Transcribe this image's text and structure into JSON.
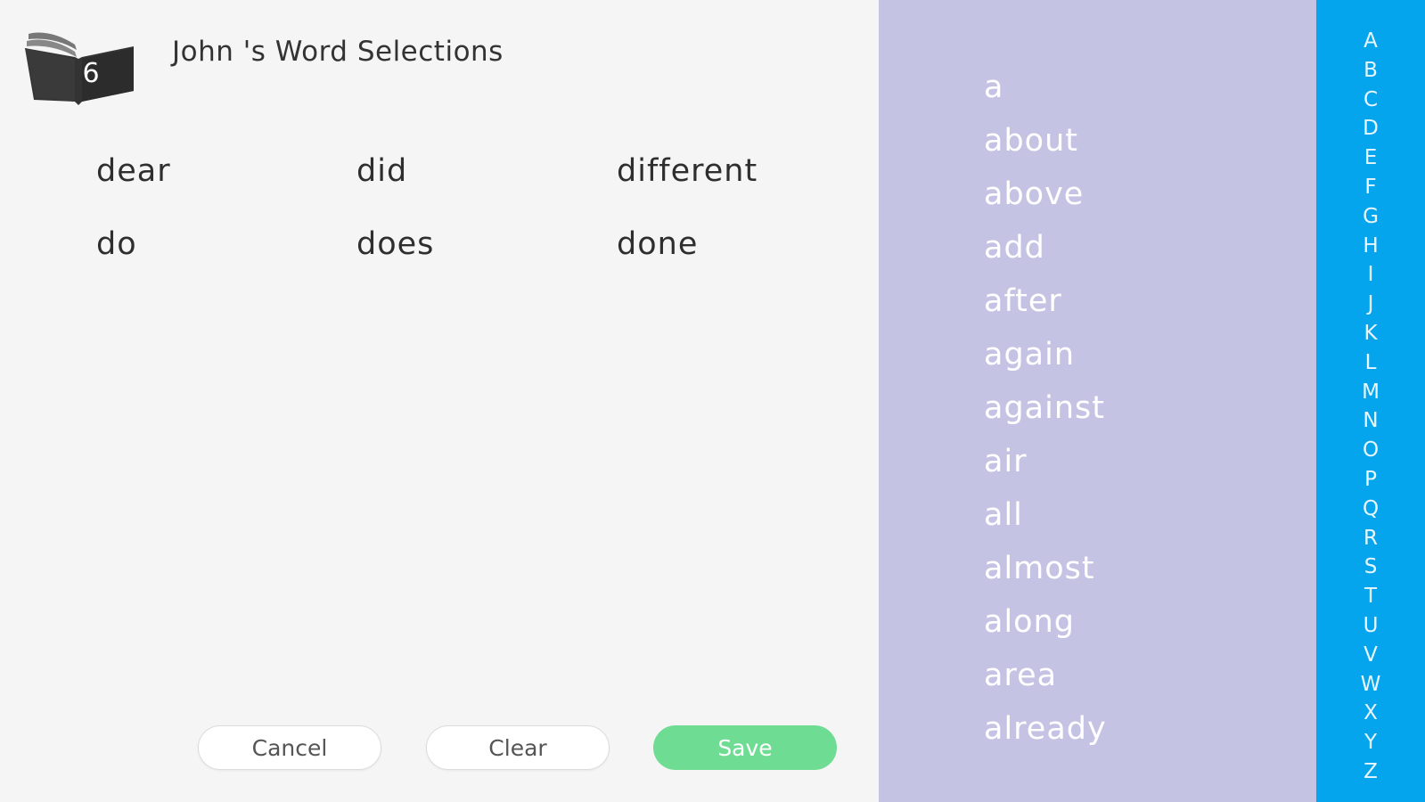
{
  "header": {
    "title": "John 's Word Selections",
    "book_level": "6"
  },
  "selected_words": [
    "dear",
    "did",
    "different",
    "do",
    "does",
    "done"
  ],
  "buttons": {
    "cancel": "Cancel",
    "clear": "Clear",
    "save": "Save"
  },
  "word_list": [
    "a",
    "about",
    "above",
    "add",
    "after",
    "again",
    "against",
    "air",
    "all",
    "almost",
    "along",
    "area",
    "already"
  ],
  "alphabet": [
    "A",
    "B",
    "C",
    "D",
    "E",
    "F",
    "G",
    "H",
    "I",
    "J",
    "K",
    "L",
    "M",
    "N",
    "O",
    "P",
    "Q",
    "R",
    "S",
    "T",
    "U",
    "V",
    "W",
    "X",
    "Y",
    "Z"
  ],
  "colors": {
    "background": "#f5f5f5",
    "word_list_panel": "#c5c3e4",
    "alphabet_bar": "#05a5ee",
    "save_button": "#6fdc94"
  }
}
